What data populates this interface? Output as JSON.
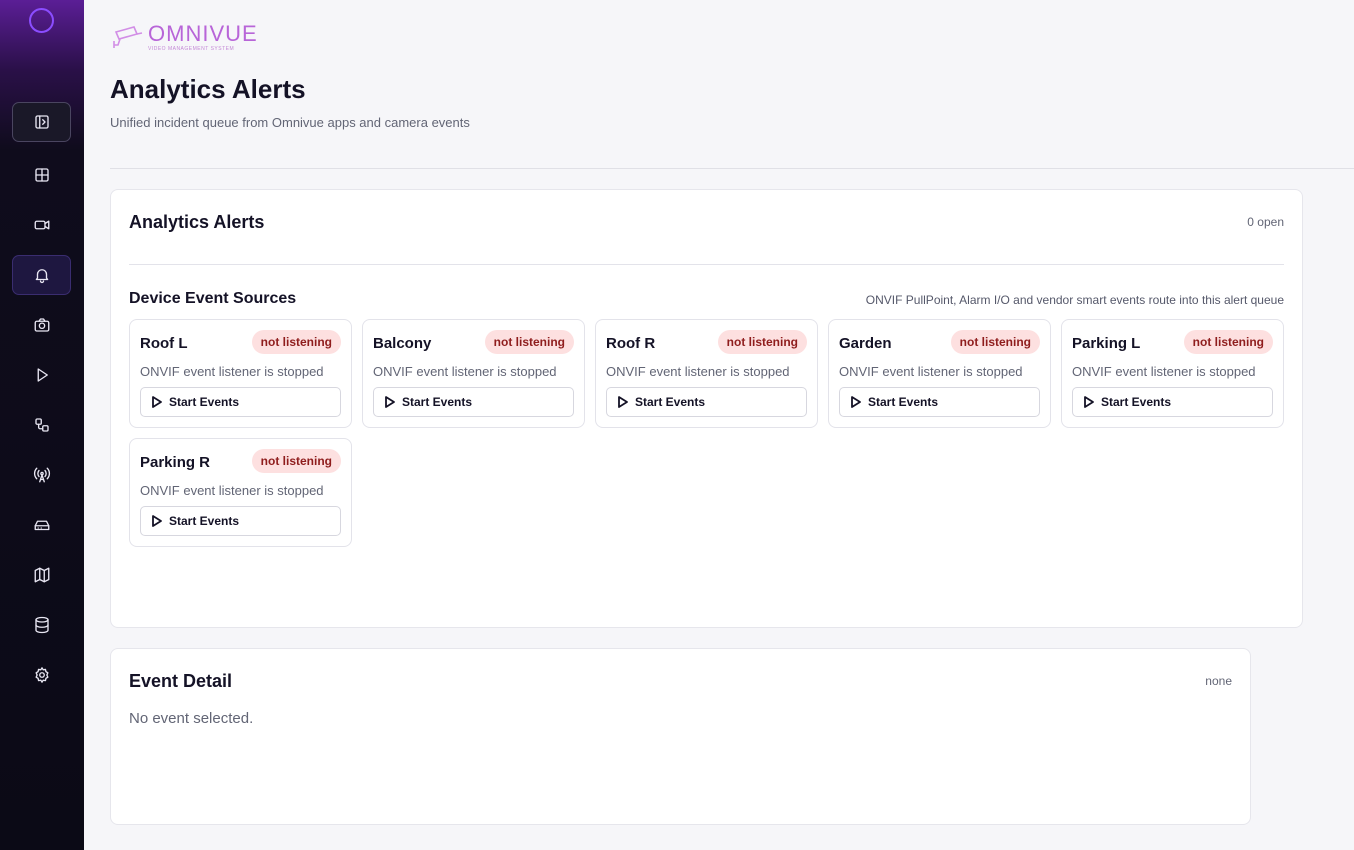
{
  "brand": {
    "name": "OMNIVUE",
    "tagline": "VIDEO MANAGEMENT SYSTEM"
  },
  "page": {
    "title": "Analytics Alerts",
    "subtitle": "Unified incident queue from Omnivue apps and camera events"
  },
  "sidebar": {
    "items": [
      {
        "icon": "panel-toggle-icon",
        "state": "toggle"
      },
      {
        "icon": "grid-icon"
      },
      {
        "icon": "video-camera-icon"
      },
      {
        "icon": "bell-icon",
        "state": "active"
      },
      {
        "icon": "camera-icon"
      },
      {
        "icon": "play-icon"
      },
      {
        "icon": "workflow-icon"
      },
      {
        "icon": "antenna-icon"
      },
      {
        "icon": "hard-drive-icon"
      },
      {
        "icon": "map-icon"
      },
      {
        "icon": "database-icon"
      },
      {
        "icon": "settings-icon"
      }
    ]
  },
  "alerts": {
    "title": "Analytics Alerts",
    "open_count": "0 open",
    "device_sources": {
      "title": "Device Event Sources",
      "note": "ONVIF PullPoint, Alarm I/O and vendor smart events route into this alert queue",
      "sources": [
        {
          "name": "Roof L",
          "badge": "not listening",
          "status": "ONVIF event listener is stopped",
          "button": "Start Events"
        },
        {
          "name": "Balcony",
          "badge": "not listening",
          "status": "ONVIF event listener is stopped",
          "button": "Start Events"
        },
        {
          "name": "Roof R",
          "badge": "not listening",
          "status": "ONVIF event listener is stopped",
          "button": "Start Events"
        },
        {
          "name": "Garden",
          "badge": "not listening",
          "status": "ONVIF event listener is stopped",
          "button": "Start Events"
        },
        {
          "name": "Parking L",
          "badge": "not listening",
          "status": "ONVIF event listener is stopped",
          "button": "Start Events"
        },
        {
          "name": "Parking R",
          "badge": "not listening",
          "status": "ONVIF event listener is stopped",
          "button": "Start Events"
        }
      ]
    }
  },
  "event_detail": {
    "title": "Event Detail",
    "meta": "none",
    "empty": "No event selected."
  },
  "colors": {
    "accent": "#8b4dff",
    "badge_bg": "#fde0e0",
    "badge_text": "#8f1d1d",
    "brand": "#b865d8"
  }
}
